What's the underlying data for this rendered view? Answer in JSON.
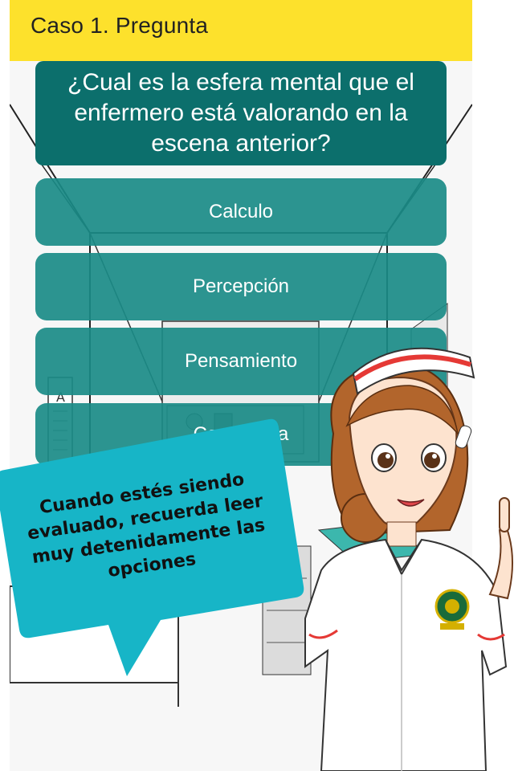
{
  "header": {
    "title": "Caso 1. Pregunta"
  },
  "question": {
    "text": "¿Cual es la esfera mental que el enfermero está valorando en la escena anterior?"
  },
  "options": [
    {
      "label": "Calculo"
    },
    {
      "label": "Percepción"
    },
    {
      "label": "Pensamiento"
    },
    {
      "label": "Conciencia"
    }
  ],
  "speech_bubble": {
    "text": "Cuando estés siendo evaluado, recuerda leer muy detenidamente las opciones"
  },
  "colors": {
    "header": "#fde12c",
    "question_bg": "#0c6f6c",
    "option_bg": "#1a8b87",
    "bubble": "#17b5c7"
  },
  "icons": [
    "nurse-character-illustration",
    "university-badge-icon",
    "nurse-cap-icon"
  ]
}
